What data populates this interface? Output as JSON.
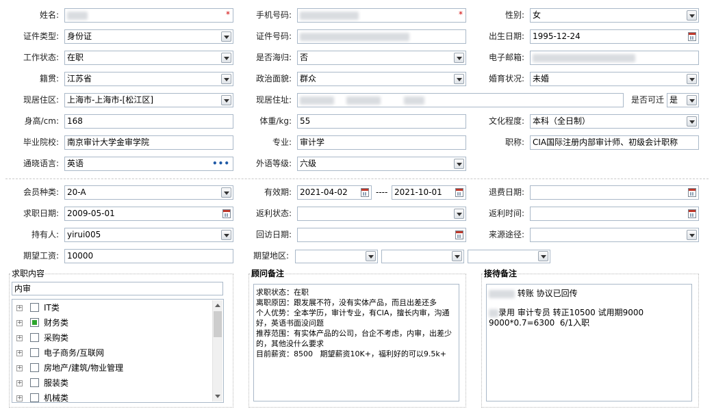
{
  "personal": {
    "name_label": "姓名:",
    "phone_label": "手机号码:",
    "gender_label": "性别:",
    "gender_value": "女",
    "id_type_label": "证件类型:",
    "id_type_value": "身份证",
    "id_no_label": "证件号码:",
    "birth_label": "出生日期:",
    "birth_value": "1995-12-24",
    "work_status_label": "工作状态:",
    "work_status_value": "在职",
    "overseas_label": "是否海归:",
    "overseas_value": "否",
    "email_label": "电子邮箱:",
    "native_label": "籍贯:",
    "native_value": "江苏省",
    "politics_label": "政治面貌:",
    "politics_value": "群众",
    "marital_label": "婚育状况:",
    "marital_value": "未婚",
    "district_label": "现居住区:",
    "district_value": "上海市-上海市-[松江区]",
    "address_label": "现居住址:",
    "relocate_label": "是否可迁",
    "relocate_value": "是",
    "height_label": "身高/cm:",
    "height_value": "168",
    "weight_label": "体重/kg:",
    "weight_value": "55",
    "education_label": "文化程度:",
    "education_value": "本科（全日制）",
    "school_label": "毕业院校:",
    "school_value": "南京审计大学金审学院",
    "major_label": "专业:",
    "major_value": "审计学",
    "title_label": "职称:",
    "title_value": "CIA国际注册内部审计师、初级会计职称",
    "language_label": "通晓语言:",
    "language_value": "英语",
    "language_more": "•••",
    "lang_level_label": "外语等级:",
    "lang_level_value": "六级",
    "required_mark": "*"
  },
  "membership": {
    "member_type_label": "会员种类:",
    "member_type_value": "20-A",
    "valid_label": "有效期:",
    "valid_from": "2021-04-02",
    "valid_sep": "----",
    "valid_to": "2021-10-01",
    "refund_date_label": "退费日期:",
    "job_date_label": "求职日期:",
    "job_date_value": "2009-05-01",
    "rebate_status_label": "返利状态:",
    "rebate_time_label": "返利时间:",
    "holder_label": "持有人:",
    "holder_value": "yirui005",
    "return_visit_label": "回访日期:",
    "source_label": "来源途径:",
    "salary_label": "期望工资:",
    "salary_value": "10000",
    "area_label": "期望地区:"
  },
  "job_content": {
    "title": "求职内容",
    "filter_value": "内审",
    "items": [
      {
        "label": "IT类",
        "state": "none"
      },
      {
        "label": "财务类",
        "state": "partial"
      },
      {
        "label": "采购类",
        "state": "none"
      },
      {
        "label": "电子商务/互联网",
        "state": "none"
      },
      {
        "label": "房地产/建筑/物业管理",
        "state": "none"
      },
      {
        "label": "服装类",
        "state": "none"
      },
      {
        "label": "机械类",
        "state": "none"
      }
    ]
  },
  "consultant": {
    "title": "顾问备注",
    "lines": [
      "求职状态：在职",
      "离职原因：跟发展不符，没有实体产品，而且出差还多",
      "个人优势：全本学历，审计专业，有CIA，擅长内审，沟通好，英语书面没问题",
      "推荐范围：有实体产品的公司，台企不考虑，内审，出差少的，其他没什么要求",
      "目前薪资：8500   期望薪资10K+，福利好的可以9.5k+"
    ]
  },
  "reception": {
    "title": "接待备注",
    "line1": "转账 协议已回传",
    "line2": "录用 审计专员 转正10500 试用期9000",
    "line3": "9000*0.7=6300  6/1入职"
  }
}
